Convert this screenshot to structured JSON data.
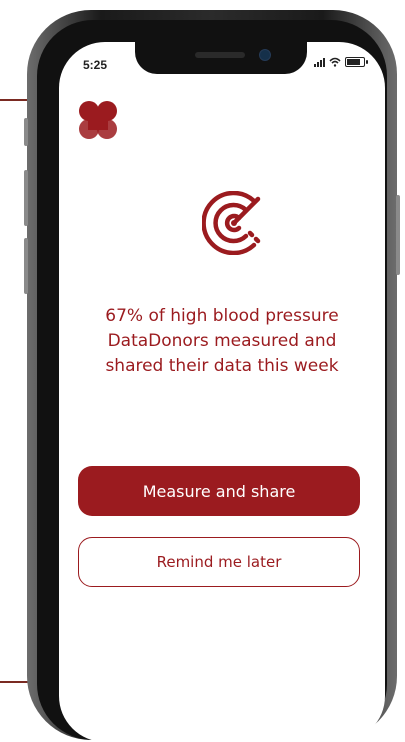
{
  "status_bar": {
    "time": "5:25",
    "signal_icon": "cellular-signal-icon",
    "wifi_icon": "wifi-icon",
    "battery_icon": "battery-icon"
  },
  "brand": {
    "logo_icon": "heart-cross-logo-icon",
    "accent_color": "#9b1b1f"
  },
  "hero": {
    "icon": "radar-icon"
  },
  "message": {
    "line1": "67% of high blood pressure",
    "line2": "DataDonors measured and",
    "line3": "shared their data this week"
  },
  "actions": {
    "primary_label": "Measure and share",
    "secondary_label": "Remind me later"
  }
}
